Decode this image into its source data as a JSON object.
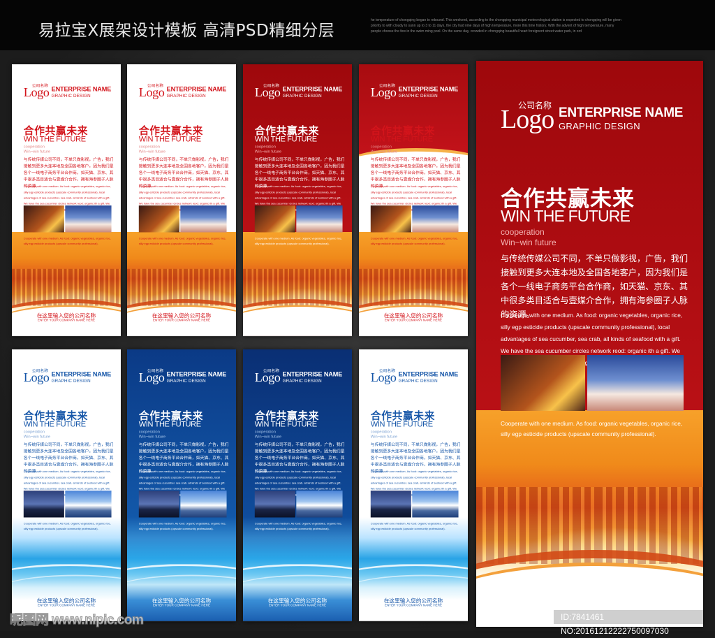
{
  "header": {
    "title": "易拉宝X展架设计模板 高清PSD精细分层",
    "blurb": "he temperature of chongqing began to rebound. This weekend, according to the chongqing municipal meteorological station is expected to chongqing will be given priority to with cloudy to sunn up to 3 to 11 days, the city had nine days of high temperature, more this time history. With the advent of high temperature, many people choose the few in the swim ming pool. On the same day, crowded in chongqing beautiful heart foreignent street water park, in ord"
  },
  "content": {
    "logo_cn": "公司名称",
    "logo": "Logo",
    "enterprise": "ENTERPRISE NAME",
    "graphic": "GRAPHIC DESIGN",
    "headline": "合作共赢未来",
    "headline_en": "WIN THE FUTURE",
    "coop": "cooperation",
    "winwin": "Win~win future",
    "body_cn": "与传统传媒公司不同，不单只做影视，广告，我们接触到更多大连本地及全国各地客户，因为我们是各个一线电子商务平台合作商，如天猫、京东、其中很多类目适合与壹媒介合作，拥有海参圈子人脉的资源。",
    "body_en": "Cooperate with one medium. As food: organic vegetables, organic rice, silly egp esticide products (upscale community professional), local advantages of sea cucumber, sea crab, all kinds of seafood with a gift. We have the sea cucumber circles network reod: organic ith a gift. We have thith a gift. We have thith a gift.",
    "caption": "Cooperate with one medium. As food: organic vegetables, organic rice, silly egp esticide products (upscale community professional).",
    "footer_cn": "在这里输入您的公司名称",
    "footer_en": "ENTER YOUR COMPANY NAME HERE"
  },
  "panels": [
    {
      "theme": "rw",
      "art": "orange"
    },
    {
      "theme": "rw",
      "art": "orange"
    },
    {
      "theme": "r",
      "art": "orange"
    },
    {
      "theme": "rt",
      "art": "orange"
    },
    {
      "theme": "bw",
      "art": "blue"
    },
    {
      "theme": "b",
      "art": "blue"
    },
    {
      "theme": "bd",
      "art": "blue"
    },
    {
      "theme": "bw",
      "art": "blue"
    },
    {
      "theme": "r",
      "art": "orange",
      "big": true
    }
  ],
  "watermark": "昵图网 www.nipic.com",
  "id_label": "ID:7841461 NO:20161212222750097030",
  "colors": {
    "red": "#b81015",
    "blue": "#1257a8",
    "orange": "#f08a1a"
  }
}
